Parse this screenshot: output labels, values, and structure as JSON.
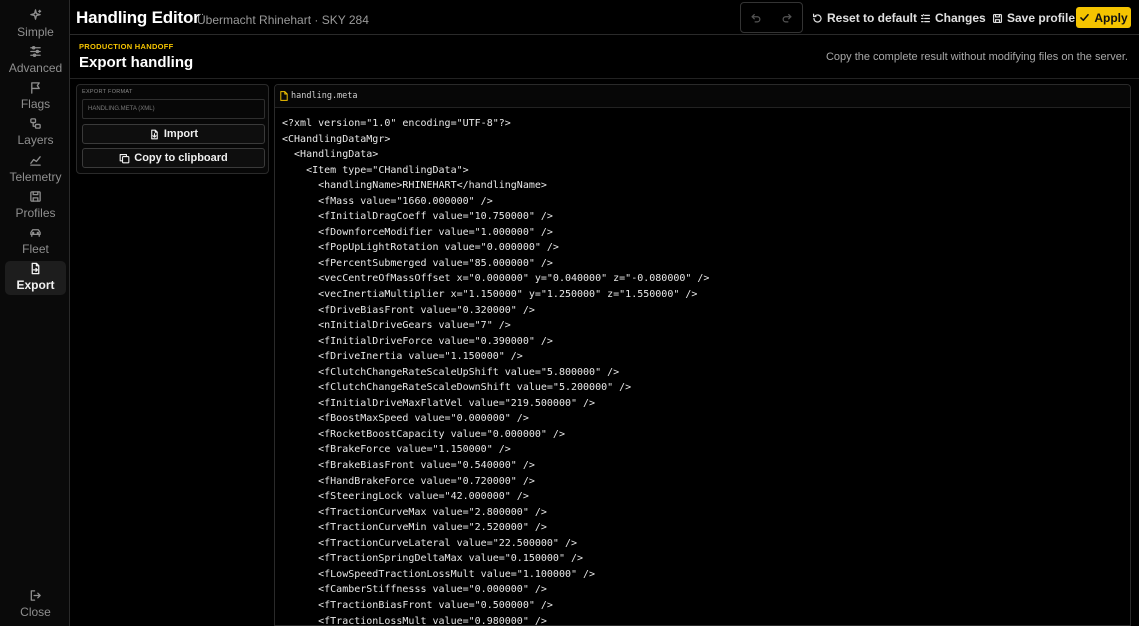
{
  "header": {
    "title": "Handling Editor",
    "subtitle": "Übermacht Rhinehart · SKY 284",
    "reset_label": "Reset to default",
    "changes_label": "Changes",
    "save_label": "Save profile",
    "apply_label": "Apply"
  },
  "sidebar": {
    "items": [
      {
        "label": "Simple",
        "icon": "sparkles-icon"
      },
      {
        "label": "Advanced",
        "icon": "sliders-icon"
      },
      {
        "label": "Flags",
        "icon": "flag-icon"
      },
      {
        "label": "Layers",
        "icon": "layers-icon"
      },
      {
        "label": "Telemetry",
        "icon": "chart-icon"
      },
      {
        "label": "Profiles",
        "icon": "save-icon"
      },
      {
        "label": "Fleet",
        "icon": "car-icon"
      },
      {
        "label": "Export",
        "icon": "file-export-icon",
        "active": true
      }
    ],
    "close_label": "Close"
  },
  "section": {
    "kicker": "PRODUCTION HANDOFF",
    "title": "Export handling",
    "note": "Copy the complete result without modifying files on the server."
  },
  "export_panel": {
    "format_label": "EXPORT FORMAT",
    "format_value": "HANDLING.META (XML)",
    "import_label": "Import",
    "copy_label": "Copy to clipboard"
  },
  "code_panel": {
    "filename": "handling.meta",
    "lines": [
      "<?xml version=\"1.0\" encoding=\"UTF-8\"?>",
      "<CHandlingDataMgr>",
      "  <HandlingData>",
      "    <Item type=\"CHandlingData\">",
      "      <handlingName>RHINEHART</handlingName>",
      "      <fMass value=\"1660.000000\" />",
      "      <fInitialDragCoeff value=\"10.750000\" />",
      "      <fDownforceModifier value=\"1.000000\" />",
      "      <fPopUpLightRotation value=\"0.000000\" />",
      "      <fPercentSubmerged value=\"85.000000\" />",
      "      <vecCentreOfMassOffset x=\"0.000000\" y=\"0.040000\" z=\"-0.080000\" />",
      "      <vecInertiaMultiplier x=\"1.150000\" y=\"1.250000\" z=\"1.550000\" />",
      "      <fDriveBiasFront value=\"0.320000\" />",
      "      <nInitialDriveGears value=\"7\" />",
      "      <fInitialDriveForce value=\"0.390000\" />",
      "      <fDriveInertia value=\"1.150000\" />",
      "      <fClutchChangeRateScaleUpShift value=\"5.800000\" />",
      "      <fClutchChangeRateScaleDownShift value=\"5.200000\" />",
      "      <fInitialDriveMaxFlatVel value=\"219.500000\" />",
      "      <fBoostMaxSpeed value=\"0.000000\" />",
      "      <fRocketBoostCapacity value=\"0.000000\" />",
      "      <fBrakeForce value=\"1.150000\" />",
      "      <fBrakeBiasFront value=\"0.540000\" />",
      "      <fHandBrakeForce value=\"0.720000\" />",
      "      <fSteeringLock value=\"42.000000\" />",
      "      <fTractionCurveMax value=\"2.800000\" />",
      "      <fTractionCurveMin value=\"2.520000\" />",
      "      <fTractionCurveLateral value=\"22.500000\" />",
      "      <fTractionSpringDeltaMax value=\"0.150000\" />",
      "      <fLowSpeedTractionLossMult value=\"1.100000\" />",
      "      <fCamberStiffnesss value=\"0.000000\" />",
      "      <fTractionBiasFront value=\"0.500000\" />",
      "      <fTractionLossMult value=\"0.980000\" />"
    ]
  },
  "colors": {
    "accent": "#f5c400",
    "background": "#000000",
    "border": "#2a2a2a"
  }
}
